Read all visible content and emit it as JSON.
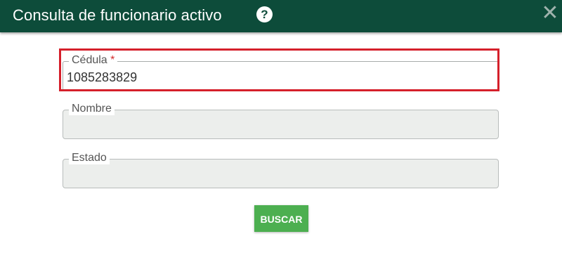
{
  "dialog": {
    "title": "Consulta de funcionario activo",
    "help_glyph": "?",
    "close_glyph": "✕",
    "icons": {
      "help": "question-circle-icon",
      "close": "close-icon"
    }
  },
  "form": {
    "cedula": {
      "label": "Cédula",
      "required_mark": "*",
      "value": "1085283829"
    },
    "nombre": {
      "label": "Nombre",
      "value": ""
    },
    "estado": {
      "label": "Estado",
      "value": ""
    },
    "search_button_label": "BUSCAR"
  },
  "colors": {
    "header_bg": "#0d4c3a",
    "highlight_border": "#d5202b",
    "button_bg": "#4caf50",
    "disabled_field_bg": "#eceeec",
    "required_mark": "#d32f2f"
  }
}
